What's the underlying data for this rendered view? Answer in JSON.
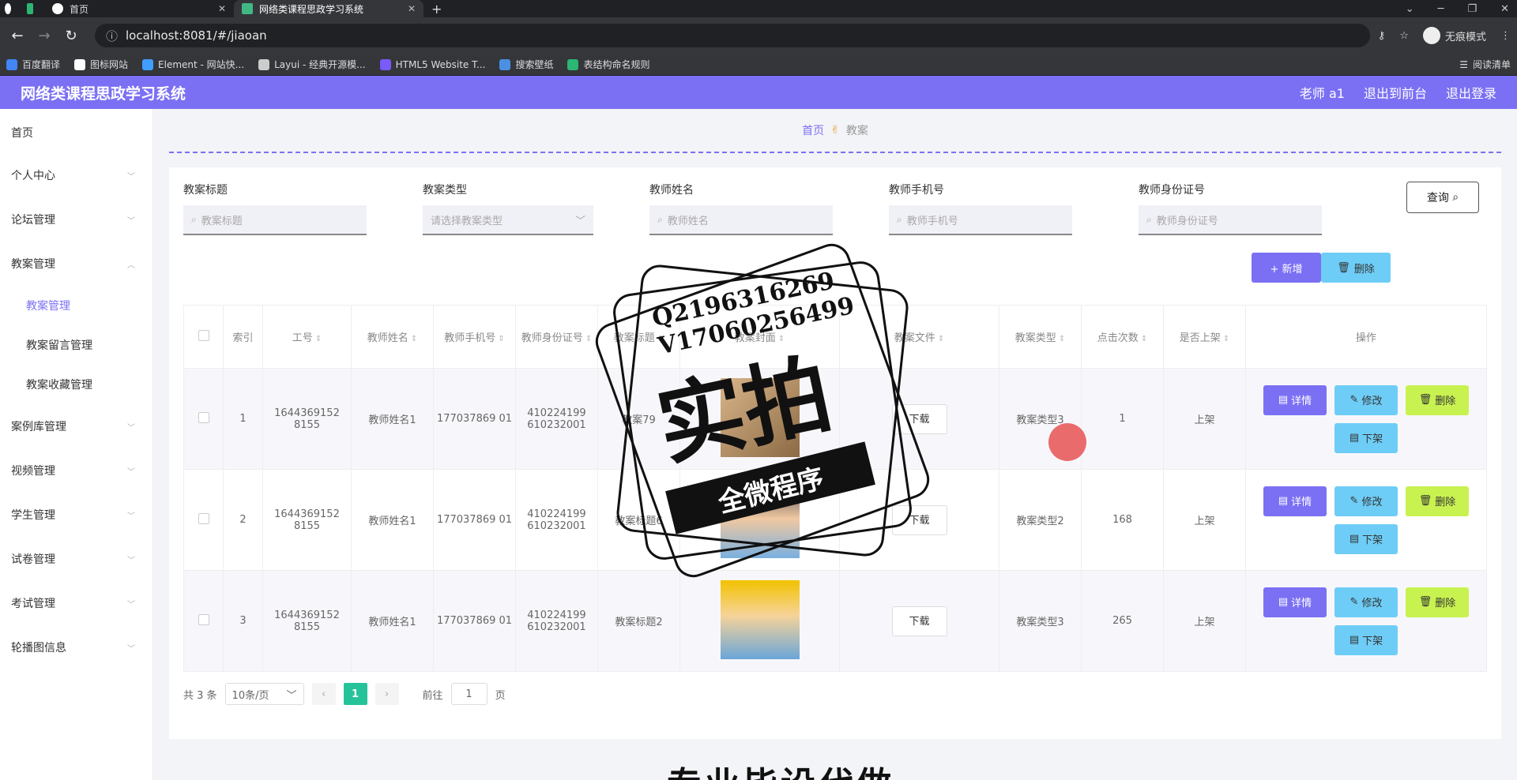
{
  "browser": {
    "tabs": [
      {
        "label": ""
      },
      {
        "label": ""
      },
      {
        "label": "首页"
      },
      {
        "label": "网络类课程思政学习系统"
      }
    ],
    "url": "localhost:8081/#/jiaoan",
    "incognito": "无痕模式",
    "bookmarks": [
      "百度翻译",
      "图标网站",
      "Element - 网站快...",
      "Layui - 经典开源模...",
      "HTML5 Website T...",
      "搜索壁纸",
      "表结构命名规则"
    ],
    "reading_list": "阅读清单"
  },
  "app": {
    "title": "网络类课程思政学习系统",
    "user": "老师 a1",
    "to_front": "退出到前台",
    "logout": "退出登录"
  },
  "sidebar": {
    "items": [
      {
        "label": "首页"
      },
      {
        "label": "个人中心"
      },
      {
        "label": "论坛管理"
      },
      {
        "label": "教案管理"
      },
      {
        "label": "教案管理"
      },
      {
        "label": "教案留言管理"
      },
      {
        "label": "教案收藏管理"
      },
      {
        "label": "案例库管理"
      },
      {
        "label": "视频管理"
      },
      {
        "label": "学生管理"
      },
      {
        "label": "试卷管理"
      },
      {
        "label": "考试管理"
      },
      {
        "label": "轮播图信息"
      }
    ]
  },
  "breadcrumb": {
    "home": "首页",
    "current": "教案"
  },
  "filters": {
    "f1_label": "教案标题",
    "f1_placeholder": "教案标题",
    "f2_label": "教案类型",
    "f2_placeholder": "请选择教案类型",
    "f3_label": "教师姓名",
    "f3_placeholder": "教师姓名",
    "f4_label": "教师手机号",
    "f4_placeholder": "教师手机号",
    "f5_label": "教师身份证号",
    "f5_placeholder": "教师身份证号",
    "query": "查询"
  },
  "actions": {
    "add": "+ 新增",
    "delete": "删除"
  },
  "table": {
    "headers": [
      "索引",
      "工号",
      "教师姓名",
      "教师手机号",
      "教师身份证号",
      "教案标题",
      "教案封面",
      "教案文件",
      "教案类型",
      "点击次数",
      "是否上架",
      "操作"
    ],
    "rows": [
      {
        "idx": "1",
        "no": "1644369152 8155",
        "name": "教师姓名1",
        "phone": "177037869 01",
        "id": "410224199 610232001",
        "title": "教案79",
        "file": "下载",
        "type": "教案类型3",
        "clicks": "1",
        "status": "上架"
      },
      {
        "idx": "2",
        "no": "1644369152 8155",
        "name": "教师姓名1",
        "phone": "177037869 01",
        "id": "410224199 610232001",
        "title": "教案标题6",
        "file": "下载",
        "type": "教案类型2",
        "clicks": "168",
        "status": "上架"
      },
      {
        "idx": "3",
        "no": "1644369152 8155",
        "name": "教师姓名1",
        "phone": "177037869 01",
        "id": "410224199 610232001",
        "title": "教案标题2",
        "file": "下载",
        "type": "教案类型3",
        "clicks": "265",
        "status": "上架"
      }
    ],
    "op_detail": "详情",
    "op_edit": "修改",
    "op_remove": "删除",
    "op_off": "下架"
  },
  "pager": {
    "total": "共 3 条",
    "size": "10条/页",
    "page": "1",
    "goto": "前往",
    "goto_val": "1",
    "page_suffix": "页"
  },
  "watermark": {
    "line1": "Q2196316269",
    "line2": "V17060256499",
    "big": "实拍",
    "ribbon": "全微程序"
  },
  "bottom_text": "专业毕设代做"
}
